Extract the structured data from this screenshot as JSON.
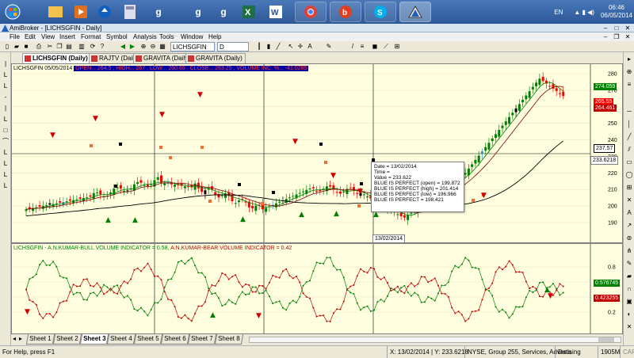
{
  "taskbar": {
    "apps": [
      "start",
      "explorer",
      "media",
      "store",
      "calculator",
      "google-chrome-g1",
      "google-chrome-g2",
      "excel",
      "word",
      "chrome",
      "powerpoint",
      "skype",
      "amibroker"
    ],
    "language": "EN",
    "time": "06:46",
    "date": "06/05/2014"
  },
  "window": {
    "title": "AmiBroker - [LICHSGFIN - Daily]"
  },
  "menu": [
    "File",
    "Edit",
    "View",
    "Insert",
    "Format",
    "Symbol",
    "Analysis",
    "Tools",
    "Window",
    "Help"
  ],
  "toolbar": {
    "symbol_value": "LICHSGFIN",
    "interval_value": "D"
  },
  "chart_tabs": [
    {
      "label": "LICHSGFIN (Daily)",
      "active": true
    },
    {
      "label": "RAJTV (Daily)",
      "active": false
    },
    {
      "label": "GRAVITA (Daily)",
      "active": false
    },
    {
      "label": "GRAVITA (Daily)",
      "active": false
    }
  ],
  "price_pane": {
    "title_symbol": "LICHSGFIN 05/05/2014",
    "title_ohlc": "OPEN... 264.5 , HIGH... 267 , LOW... 260.65 , CLOSE... 263.25 , VOLUME INC. %... -41.0285",
    "y_ticks": [
      "280",
      "270",
      "260",
      "250",
      "240",
      "230",
      "220",
      "210",
      "200",
      "190"
    ],
    "value_boxes": {
      "ma1": "274.059",
      "close": "265.55",
      "ma2": "264.461",
      "ma_long": "237.57",
      "cursor": "233.6218"
    }
  },
  "tooltip": {
    "lines": [
      "Date = 13/02/2014",
      "Time =",
      "Value = 233.622",
      "BLUE IS PERFECT (open) = 199.872",
      "BLUE IS PERFECT (high) = 201.414",
      "BLUE IS PERFECT (low) = 196.966",
      "BLUE IS PERFECT  = 198.421"
    ]
  },
  "date_flag": "13/02/2014",
  "indicator_pane": {
    "title_bull": "LICHSGFIN - A.N.KUMAR-BULL VOLUME INDICATOR = 0.58,",
    "title_bear": "A.N.KUMAR-BEAR VOLUME INDICATOR = 0.42",
    "y_ticks": [
      "0.8",
      "0.6",
      "0.4",
      "0.2"
    ],
    "value_boxes": {
      "bull": "0.576745",
      "bear": "0.423255"
    }
  },
  "sheets": [
    "Sheet 1",
    "Sheet 2",
    "Sheet 3",
    "Sheet 4",
    "Sheet 5",
    "Sheet 6",
    "Sheet 7",
    "Sheet 8"
  ],
  "active_sheet": 2,
  "status": {
    "help": "For Help, press F1",
    "coords": "X: 13/02/2014 | Y: 233.6218",
    "exchange": "NYSE, Group 255, Services, Advertising",
    "mode": "Data",
    "memory": "1905M",
    "caps": "CAP"
  },
  "colors": {
    "background": "#ffffe0",
    "up_candle": "#008000",
    "down_candle": "#ff0000",
    "ma_short": "#008000",
    "ma_mid": "#800000",
    "ma_long": "#000000",
    "bull_line": "#008000",
    "bear_line": "#c00000"
  }
}
